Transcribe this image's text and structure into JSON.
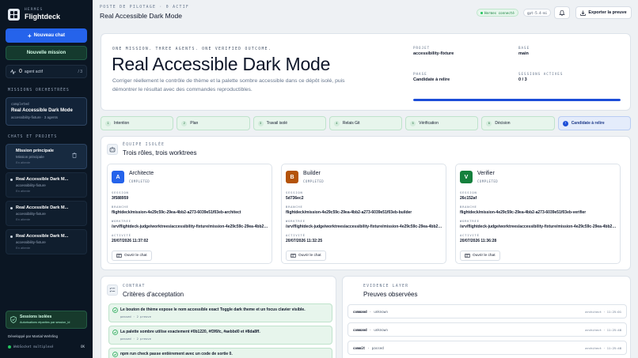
{
  "brand": {
    "kicker": "HERMES",
    "name": "Flightdeck"
  },
  "sidebar": {
    "new_chat": "Nouveau chat",
    "new_mission": "Nouvelle mission",
    "agents": {
      "count": "0",
      "label": "agent actif",
      "total": "/ 3"
    },
    "orchestrated_section": "MISSIONS ORCHESTRÉES",
    "orchestrated": {
      "status": "completed",
      "title": "Real Accessible Dark Mode",
      "sub": "accessibility-fixture · 3 agents"
    },
    "chats_section": "CHATS ET PROJETS",
    "chats": [
      {
        "title": "Mission principale",
        "sub": "Mission principale",
        "time": "En attente"
      },
      {
        "title": "Real Accessible Dark M...",
        "sub": "accessibility-fixture",
        "time": "En attente"
      },
      {
        "title": "Real Accessible Dark M...",
        "sub": "accessibility-fixture",
        "time": "En attente"
      },
      {
        "title": "Real Accessible Dark M...",
        "sub": "accessibility-fixture",
        "time": "En attente"
      }
    ],
    "sessions": {
      "title": "Sessions isolées",
      "sub": "Autorisations réparties par session_id"
    },
    "developed_by": "Développé par Martial Wehrling",
    "websocket": {
      "label": "WebSocket multiplexé",
      "status": "OK"
    }
  },
  "header": {
    "kicker": "POSTE DE PILOTAGE · 0 ACTIF",
    "title": "Real Accessible Dark Mode",
    "connected": "Hermes connecté",
    "model": "gpt-5.4-mi",
    "export": "Exporter la preuve"
  },
  "hero": {
    "kicker": "ONE MISSION. THREE AGENTS. ONE VERIFIED OUTCOME.",
    "title": "Real Accessible Dark Mode",
    "description": "Corriger réellement le contrôle de thème et la palette sombre accessible dans ce dépôt isolé, puis démontrer le résultat avec des commandes reproductibles.",
    "project_label": "PROJET",
    "project": "accessibility-fixture",
    "base_label": "BASE",
    "base": "main",
    "phase_label": "PHASE",
    "phase": "Candidate à relire",
    "sessions_label": "SESSIONS ACTIVES",
    "sessions": "0 / 3",
    "progress": 1.0
  },
  "steps": [
    {
      "num": "1",
      "label": "Intention"
    },
    {
      "num": "2",
      "label": "Plan"
    },
    {
      "num": "3",
      "label": "Travail isolé"
    },
    {
      "num": "4",
      "label": "Relais Git"
    },
    {
      "num": "5",
      "label": "Vérification"
    },
    {
      "num": "6",
      "label": "Décision"
    },
    {
      "num": "7",
      "label": "Candidate à relire"
    }
  ],
  "agents_panel": {
    "kicker": "ÉQUIPE ISOLÉE",
    "title": "Trois rôles, trois worktrees",
    "labels": {
      "session": "SESSION",
      "branch": "BRANCHE",
      "worktree": "WORKTREE",
      "activity": "ACTIVITÉ"
    },
    "open_chat": "Ouvrir le chat",
    "agents": [
      {
        "initial": "A",
        "name": "Architecte",
        "status": "COMPLETED",
        "session": "3f588959",
        "branch": "flightdeck/mission-4e29c59c-29ea-4bb2-a273-6039e51f03eb-architect",
        "worktree": "/srv/flightdeck-judge/worktrees/accessibility-fixture/mission-4e29c59c-29ea-4bb2-a273-6039e51f03eb-architect",
        "activity": "20/07/2026 11:37:02",
        "color": "#2563eb"
      },
      {
        "initial": "B",
        "name": "Builder",
        "status": "COMPLETED",
        "session": "5d736ec2",
        "branch": "flightdeck/mission-4e29c59c-29ea-4bb2-a273-6039e51f03eb-builder",
        "worktree": "/srv/flightdeck-judge/worktrees/accessibility-fixture/mission-4e29c59c-29ea-4bb2-a273-6039e51f03eb-builder",
        "activity": "20/07/2026 11:32:25",
        "color": "#b45309"
      },
      {
        "initial": "V",
        "name": "Verifier",
        "status": "COMPLETED",
        "session": "26c152af",
        "branch": "flightdeck/mission-4e29c59c-29ea-4bb2-a273-6039e51f03eb-verifier",
        "worktree": "/srv/flightdeck-judge/worktrees/accessibility-fixture/mission-4e29c59c-29ea-4bb2-a273-6039e51f03eb-verifier",
        "activity": "20/07/2026 11:36:28",
        "color": "#15803d"
      }
    ]
  },
  "contract": {
    "kicker": "CONTRAT",
    "title": "Critères d'acceptation",
    "criteria": [
      {
        "text": "Le bouton de thème expose le nom accessible exact Toggle dark theme et un focus clavier visible.",
        "meta": "passed · 2 preuve"
      },
      {
        "text": "La palette sombre utilise exactement #0b1220, #f3f6fc, #aebbd0 et #8da8ff.",
        "meta": "passed · 2 preuve"
      },
      {
        "text": "npm run check passe entièrement avec un code de sortie 0.",
        "meta": ""
      }
    ]
  },
  "evidence": {
    "kicker": "EVIDENCE LAYER",
    "title": "Preuves observées",
    "rows": [
      {
        "kind": "command",
        "state": "unknown",
        "right": "architect · 11:25:01"
      },
      {
        "kind": "command",
        "state": "unknown",
        "right": "architect · 11:25:48"
      },
      {
        "kind": "commit",
        "state": "passed",
        "right": "architect · 11:25:48"
      }
    ]
  }
}
